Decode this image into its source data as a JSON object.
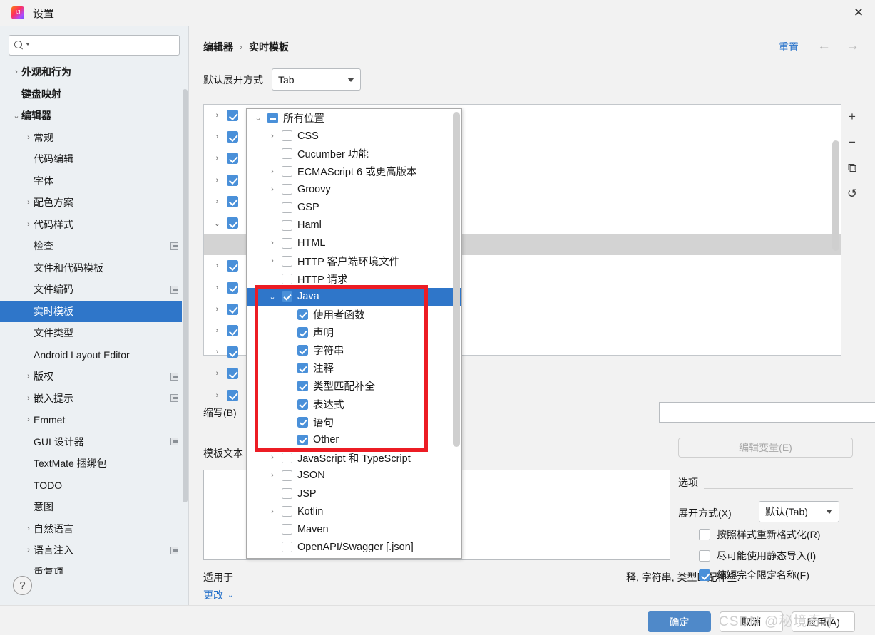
{
  "window": {
    "title": "设置",
    "app_icon": "intellij-idea-icon",
    "close_label": "✕"
  },
  "search": {
    "placeholder": "",
    "value": "",
    "icon": "search-icon"
  },
  "sidebar": {
    "items": [
      {
        "label": "外观和行为",
        "level": 0,
        "arrow": "›",
        "expanded": false,
        "selected": false,
        "modified": false
      },
      {
        "label": "键盘映射",
        "level": 0,
        "arrow": "",
        "expanded": false,
        "selected": false,
        "modified": false
      },
      {
        "label": "编辑器",
        "level": 0,
        "arrow": "⌄",
        "expanded": true,
        "selected": false,
        "modified": false
      },
      {
        "label": "常规",
        "level": 1,
        "arrow": "›",
        "expanded": false,
        "selected": false,
        "modified": false
      },
      {
        "label": "代码编辑",
        "level": 1,
        "arrow": "",
        "expanded": false,
        "selected": false,
        "modified": false
      },
      {
        "label": "字体",
        "level": 1,
        "arrow": "",
        "expanded": false,
        "selected": false,
        "modified": false
      },
      {
        "label": "配色方案",
        "level": 1,
        "arrow": "›",
        "expanded": false,
        "selected": false,
        "modified": false
      },
      {
        "label": "代码样式",
        "level": 1,
        "arrow": "›",
        "expanded": false,
        "selected": false,
        "modified": false
      },
      {
        "label": "检查",
        "level": 1,
        "arrow": "",
        "expanded": false,
        "selected": false,
        "modified": true
      },
      {
        "label": "文件和代码模板",
        "level": 1,
        "arrow": "",
        "expanded": false,
        "selected": false,
        "modified": false
      },
      {
        "label": "文件编码",
        "level": 1,
        "arrow": "",
        "expanded": false,
        "selected": false,
        "modified": true
      },
      {
        "label": "实时模板",
        "level": 1,
        "arrow": "",
        "expanded": false,
        "selected": true,
        "modified": false
      },
      {
        "label": "文件类型",
        "level": 1,
        "arrow": "",
        "expanded": false,
        "selected": false,
        "modified": false
      },
      {
        "label": "Android Layout Editor",
        "level": 1,
        "arrow": "",
        "expanded": false,
        "selected": false,
        "modified": false
      },
      {
        "label": "版权",
        "level": 1,
        "arrow": "›",
        "expanded": false,
        "selected": false,
        "modified": true
      },
      {
        "label": "嵌入提示",
        "level": 1,
        "arrow": "›",
        "expanded": false,
        "selected": false,
        "modified": true
      },
      {
        "label": "Emmet",
        "level": 1,
        "arrow": "›",
        "expanded": false,
        "selected": false,
        "modified": false
      },
      {
        "label": "GUI 设计器",
        "level": 1,
        "arrow": "",
        "expanded": false,
        "selected": false,
        "modified": true
      },
      {
        "label": "TextMate 捆绑包",
        "level": 1,
        "arrow": "",
        "expanded": false,
        "selected": false,
        "modified": false
      },
      {
        "label": "TODO",
        "level": 1,
        "arrow": "",
        "expanded": false,
        "selected": false,
        "modified": false
      },
      {
        "label": "意图",
        "level": 1,
        "arrow": "",
        "expanded": false,
        "selected": false,
        "modified": false
      },
      {
        "label": "自然语言",
        "level": 1,
        "arrow": "›",
        "expanded": false,
        "selected": false,
        "modified": false
      },
      {
        "label": "语言注入",
        "level": 1,
        "arrow": "›",
        "expanded": false,
        "selected": false,
        "modified": true
      },
      {
        "label": "重复项",
        "level": 1,
        "arrow": "",
        "expanded": false,
        "selected": false,
        "modified": false
      }
    ]
  },
  "header": {
    "breadcrumb_parent": "编辑器",
    "breadcrumb_sep": "›",
    "breadcrumb_current": "实时模板",
    "reset_label": "重置",
    "back_icon": "arrow-left-icon",
    "forward_icon": "arrow-right-icon"
  },
  "expand_row": {
    "label": "默认展开方式",
    "value": "Tab"
  },
  "tree_tools": {
    "add": "+",
    "remove": "−",
    "duplicate": "⧉",
    "revert": "↺"
  },
  "background_tree": {
    "rows": [
      {
        "arrow": "›",
        "checked": true,
        "gray": false
      },
      {
        "arrow": "›",
        "checked": true,
        "gray": false
      },
      {
        "arrow": "›",
        "checked": true,
        "gray": false
      },
      {
        "arrow": "›",
        "checked": true,
        "gray": false
      },
      {
        "arrow": "›",
        "checked": true,
        "gray": false
      },
      {
        "arrow": "⌄",
        "checked": true,
        "gray": false
      },
      {
        "arrow": "",
        "checked": false,
        "gray": true
      },
      {
        "arrow": "›",
        "checked": true,
        "gray": false
      },
      {
        "arrow": "›",
        "checked": true,
        "gray": false
      },
      {
        "arrow": "›",
        "checked": true,
        "gray": false
      },
      {
        "arrow": "›",
        "checked": true,
        "gray": false
      },
      {
        "arrow": "›",
        "checked": true,
        "gray": false
      },
      {
        "arrow": "›",
        "checked": true,
        "gray": false
      },
      {
        "arrow": "›",
        "checked": true,
        "gray": false
      }
    ]
  },
  "popup": {
    "rows": [
      {
        "label": "所有位置",
        "indent": 0,
        "arrow": "⌄",
        "state": "dash",
        "selected": false
      },
      {
        "label": "CSS",
        "indent": 1,
        "arrow": "›",
        "state": "off",
        "selected": false
      },
      {
        "label": "Cucumber 功能",
        "indent": 1,
        "arrow": "",
        "state": "off",
        "selected": false
      },
      {
        "label": "ECMAScript 6 或更高版本",
        "indent": 1,
        "arrow": "›",
        "state": "off",
        "selected": false
      },
      {
        "label": "Groovy",
        "indent": 1,
        "arrow": "›",
        "state": "off",
        "selected": false
      },
      {
        "label": "GSP",
        "indent": 1,
        "arrow": "",
        "state": "off",
        "selected": false
      },
      {
        "label": "Haml",
        "indent": 1,
        "arrow": "",
        "state": "off",
        "selected": false
      },
      {
        "label": "HTML",
        "indent": 1,
        "arrow": "›",
        "state": "off",
        "selected": false
      },
      {
        "label": "HTTP 客户端环境文件",
        "indent": 1,
        "arrow": "›",
        "state": "off",
        "selected": false
      },
      {
        "label": "HTTP 请求",
        "indent": 1,
        "arrow": "",
        "state": "off",
        "selected": false
      },
      {
        "label": "Java",
        "indent": 1,
        "arrow": "⌄",
        "state": "on",
        "selected": true
      },
      {
        "label": "使用者函数",
        "indent": 2,
        "arrow": "",
        "state": "on",
        "selected": false
      },
      {
        "label": "声明",
        "indent": 2,
        "arrow": "",
        "state": "on",
        "selected": false
      },
      {
        "label": "字符串",
        "indent": 2,
        "arrow": "",
        "state": "on",
        "selected": false
      },
      {
        "label": "注释",
        "indent": 2,
        "arrow": "",
        "state": "on",
        "selected": false
      },
      {
        "label": "类型匹配补全",
        "indent": 2,
        "arrow": "",
        "state": "on",
        "selected": false
      },
      {
        "label": "表达式",
        "indent": 2,
        "arrow": "",
        "state": "on",
        "selected": false
      },
      {
        "label": "语句",
        "indent": 2,
        "arrow": "",
        "state": "on",
        "selected": false
      },
      {
        "label": "Other",
        "indent": 2,
        "arrow": "",
        "state": "on",
        "selected": false
      },
      {
        "label": "JavaScript 和 TypeScript",
        "indent": 1,
        "arrow": "›",
        "state": "off",
        "selected": false
      },
      {
        "label": "JSON",
        "indent": 1,
        "arrow": "›",
        "state": "off",
        "selected": false
      },
      {
        "label": "JSP",
        "indent": 1,
        "arrow": "",
        "state": "off",
        "selected": false
      },
      {
        "label": "Kotlin",
        "indent": 1,
        "arrow": "›",
        "state": "off",
        "selected": false
      },
      {
        "label": "Maven",
        "indent": 1,
        "arrow": "",
        "state": "off",
        "selected": false
      },
      {
        "label": "OpenAPI/Swagger [.json]",
        "indent": 1,
        "arrow": "",
        "state": "off",
        "selected": false
      }
    ]
  },
  "form": {
    "abbrev_label": "缩写(B)",
    "abbrev_value": "",
    "description_value": "",
    "template_label": "模板文本",
    "template_value": "",
    "edit_variables_label": "编辑变量(E)",
    "applies_label": "适用于",
    "applies_text": "释, 字符串, 类型匹配补全.",
    "change_label": "更改",
    "change_caret": "⌄"
  },
  "options": {
    "title": "选项",
    "expand_label": "展开方式(X)",
    "expand_value": "默认(Tab)",
    "checkboxes": [
      {
        "label": "按照样式重新格式化(R)",
        "checked": false
      },
      {
        "label": "尽可能使用静态导入(I)",
        "checked": false
      },
      {
        "label": "缩短完全限定名称(F)",
        "checked": true
      }
    ]
  },
  "footer": {
    "help_icon": "?",
    "ok_label": "确定",
    "cancel_label": "取消",
    "apply_label": "应用(A)"
  },
  "watermark": {
    "text": "CSDN @秘境奇才"
  },
  "colors": {
    "accent": "#2f76c9",
    "checkbox": "#4a90d9",
    "link": "#2470c9",
    "annotation": "#ec1c24",
    "primary_button": "#4f89c9"
  }
}
